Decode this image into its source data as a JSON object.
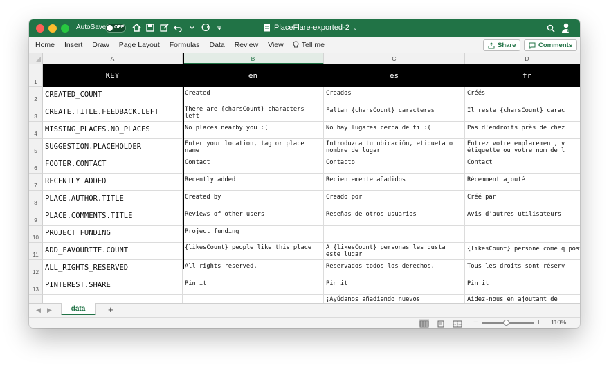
{
  "titlebar": {
    "autosave_label": "AutoSave",
    "autosave_state": "OFF",
    "document_title": "PlaceFlare-exported-2",
    "accent_color": "#217346"
  },
  "ribbon": {
    "menu": [
      "Home",
      "Insert",
      "Draw",
      "Page Layout",
      "Formulas",
      "Data",
      "Review",
      "View"
    ],
    "tell_me": "Tell me",
    "share": "Share",
    "comments": "Comments"
  },
  "grid": {
    "columns": [
      "A",
      "B",
      "C",
      "D"
    ],
    "selected_column": "B",
    "header_row": [
      "KEY",
      "en",
      "es",
      "fr"
    ],
    "rows": [
      {
        "num": "1"
      },
      {
        "num": "2",
        "cells": [
          "CREATED_COUNT",
          "Created",
          "Creados",
          "Créés"
        ]
      },
      {
        "num": "3",
        "cells": [
          "CREATE.TITLE.FEEDBACK.LEFT",
          "There are {charsCount} characters left",
          "Faltan {charsCount} caracteres",
          "Il reste {charsCount} carac"
        ]
      },
      {
        "num": "4",
        "cells": [
          "MISSING_PLACES.NO_PLACES",
          "No places nearby you :(",
          "No hay lugares cerca de ti :(",
          "Pas d'endroits près de chez"
        ]
      },
      {
        "num": "5",
        "cells": [
          "SUGGESTION.PLACEHOLDER",
          "Enter your location, tag or place name",
          "Introduzca tu ubicación, etiqueta o nombre de lugar",
          "Entrez votre emplacement, v étiquette ou votre nom de l"
        ]
      },
      {
        "num": "6",
        "cells": [
          "FOOTER.CONTACT",
          "Contact",
          "Contacto",
          "Contact"
        ]
      },
      {
        "num": "7",
        "cells": [
          "RECENTLY_ADDED",
          "Recently added",
          "Recientemente añadidos",
          "Récemment ajouté"
        ]
      },
      {
        "num": "8",
        "cells": [
          "PLACE.AUTHOR.TITLE",
          "Created by",
          "Creado por",
          "Créé par"
        ]
      },
      {
        "num": "9",
        "cells": [
          "PLACE.COMMENTS.TITLE",
          "Reviews of other users",
          "Reseñas de otros usuarios",
          "Avis d'autres utilisateurs"
        ]
      },
      {
        "num": "10",
        "cells": [
          "PROJECT_FUNDING",
          "Project funding",
          "",
          ""
        ]
      },
      {
        "num": "11",
        "cells": [
          "ADD_FAVOURITE.COUNT",
          "{likesCount} people like this place",
          "A {likesCount} personas les gusta este lugar",
          "{likesCount} persone come q posto"
        ]
      },
      {
        "num": "12",
        "cells": [
          "ALL_RIGHTS_RESERVED",
          "All rights reserved.",
          "Reservados todos los derechos.",
          "Tous les droits sont réserv"
        ]
      },
      {
        "num": "13",
        "cells": [
          "PINTEREST.SHARE",
          "Pin it",
          "Pin it",
          "Pin it"
        ]
      },
      {
        "num": "",
        "cells": [
          "",
          "",
          "¡Ayúdanos añadiendo nuevos",
          "Aidez-nous en ajoutant de"
        ]
      }
    ]
  },
  "sheets": {
    "active": "data",
    "add_label": "+"
  },
  "status": {
    "zoom_minus": "−",
    "zoom_plus": "+",
    "zoom_level": "110%",
    "zoom_fraction": 0.47
  }
}
